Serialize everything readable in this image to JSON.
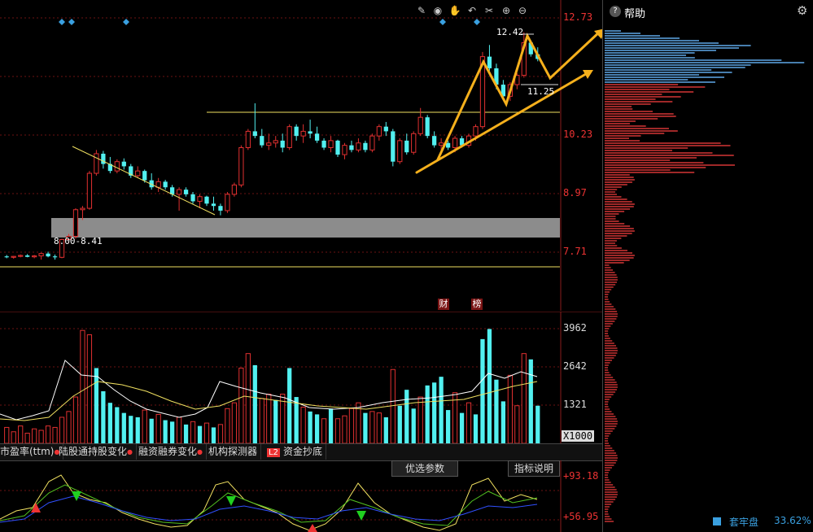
{
  "toolbar": {
    "icons": [
      "pen-icon",
      "eye-icon",
      "hand-icon",
      "undo-icon",
      "scissors-icon",
      "zoom-in-icon",
      "zoom-out-icon"
    ]
  },
  "price_axis": {
    "ticks": [
      "12.73",
      "10.23",
      "8.97",
      "7.71"
    ]
  },
  "annotations": {
    "support_zone_label": "8.00-8.41",
    "high_label": "12.42",
    "low_label": "11.25",
    "finance_badge": "财",
    "ranking_badge": "榜"
  },
  "volume_axis": {
    "ticks": [
      "3962",
      "2642",
      "1321"
    ],
    "unit": "X1000"
  },
  "indicator_tabs": [
    {
      "label": "市盈率(ttm)"
    },
    {
      "label": "陆股通持股变化"
    },
    {
      "label": "融资融券变化"
    },
    {
      "label": "机构探测器"
    },
    {
      "label": "资金抄底",
      "badge": "L2"
    }
  ],
  "indicator_panel": {
    "optimize_button": "优选参数",
    "explain_button": "指标说明",
    "ticks": [
      "+93.18",
      "+56.95"
    ]
  },
  "sidebar": {
    "help_title": "帮助",
    "footer_label": "套牢盘",
    "footer_value": "33.62%"
  },
  "colors": {
    "up": "#e03030",
    "down": "#52f0f0",
    "accent": "#f5b01c",
    "trend": "#f0e060"
  },
  "chart_data": {
    "type": "candlestick",
    "y_range": [
      7.2,
      12.9
    ],
    "candles": [
      [
        7.62,
        7.65,
        7.58,
        7.6
      ],
      [
        7.6,
        7.63,
        7.57,
        7.62
      ],
      [
        7.62,
        7.66,
        7.6,
        7.64
      ],
      [
        7.64,
        7.67,
        7.6,
        7.61
      ],
      [
        7.61,
        7.65,
        7.58,
        7.63
      ],
      [
        7.63,
        7.7,
        7.55,
        7.68
      ],
      [
        7.68,
        7.72,
        7.6,
        7.62
      ],
      [
        7.62,
        7.66,
        7.55,
        7.6
      ],
      [
        7.6,
        8.0,
        7.58,
        7.98
      ],
      [
        7.98,
        8.1,
        7.9,
        8.05
      ],
      [
        8.05,
        8.65,
        8.0,
        8.62
      ],
      [
        8.62,
        8.7,
        8.4,
        8.65
      ],
      [
        8.65,
        9.45,
        8.62,
        9.4
      ],
      [
        9.4,
        9.9,
        9.35,
        9.82
      ],
      [
        9.82,
        9.88,
        9.5,
        9.6
      ],
      [
        9.6,
        9.75,
        9.4,
        9.45
      ],
      [
        9.45,
        9.7,
        9.4,
        9.65
      ],
      [
        9.65,
        9.72,
        9.48,
        9.55
      ],
      [
        9.55,
        9.6,
        9.3,
        9.35
      ],
      [
        9.35,
        9.55,
        9.3,
        9.45
      ],
      [
        9.45,
        9.48,
        9.2,
        9.25
      ],
      [
        9.25,
        9.4,
        9.05,
        9.1
      ],
      [
        9.1,
        9.3,
        9.0,
        9.22
      ],
      [
        9.22,
        9.26,
        9.05,
        9.1
      ],
      [
        9.1,
        9.15,
        8.9,
        8.95
      ],
      [
        8.95,
        9.1,
        8.6,
        9.05
      ],
      [
        9.05,
        9.1,
        8.9,
        8.95
      ],
      [
        8.95,
        9.0,
        8.75,
        8.8
      ],
      [
        8.8,
        8.95,
        8.65,
        8.9
      ],
      [
        8.9,
        8.92,
        8.7,
        8.75
      ],
      [
        8.75,
        8.9,
        8.6,
        8.7
      ],
      [
        8.7,
        8.75,
        8.5,
        8.6
      ],
      [
        8.6,
        9.0,
        8.55,
        8.95
      ],
      [
        8.95,
        9.2,
        8.9,
        9.15
      ],
      [
        9.15,
        10.0,
        9.1,
        9.95
      ],
      [
        9.95,
        10.35,
        9.9,
        10.3
      ],
      [
        10.3,
        10.9,
        10.15,
        10.2
      ],
      [
        10.2,
        10.35,
        9.95,
        10.0
      ],
      [
        10.0,
        10.25,
        9.9,
        10.05
      ],
      [
        10.05,
        10.2,
        9.95,
        10.1
      ],
      [
        10.1,
        10.25,
        9.85,
        9.95
      ],
      [
        9.95,
        10.45,
        9.9,
        10.4
      ],
      [
        10.4,
        10.45,
        10.1,
        10.2
      ],
      [
        10.2,
        10.45,
        10.05,
        10.3
      ],
      [
        10.3,
        10.55,
        10.15,
        10.25
      ],
      [
        10.25,
        10.4,
        10.05,
        10.1
      ],
      [
        10.1,
        10.15,
        9.9,
        9.95
      ],
      [
        9.95,
        10.2,
        9.85,
        10.1
      ],
      [
        10.1,
        10.12,
        9.75,
        9.8
      ],
      [
        9.8,
        10.05,
        9.7,
        10.0
      ],
      [
        10.0,
        10.1,
        9.85,
        9.9
      ],
      [
        9.9,
        10.15,
        9.85,
        10.05
      ],
      [
        10.05,
        10.1,
        9.85,
        9.9
      ],
      [
        9.9,
        10.25,
        9.85,
        10.2
      ],
      [
        10.2,
        10.45,
        10.1,
        10.4
      ],
      [
        10.4,
        10.5,
        10.2,
        10.3
      ],
      [
        10.3,
        10.35,
        9.55,
        9.65
      ],
      [
        9.65,
        10.15,
        9.6,
        10.1
      ],
      [
        10.1,
        10.25,
        9.8,
        9.85
      ],
      [
        9.85,
        10.3,
        9.8,
        10.25
      ],
      [
        10.25,
        10.8,
        10.2,
        10.6
      ],
      [
        10.6,
        10.65,
        10.15,
        10.2
      ],
      [
        10.2,
        10.3,
        9.95,
        10.0
      ],
      [
        10.0,
        10.15,
        9.8,
        10.05
      ],
      [
        10.05,
        10.1,
        9.9,
        9.95
      ],
      [
        9.95,
        10.2,
        9.85,
        10.15
      ],
      [
        10.15,
        10.2,
        9.95,
        10.0
      ],
      [
        10.0,
        10.25,
        9.95,
        10.2
      ],
      [
        10.2,
        10.45,
        10.1,
        10.4
      ],
      [
        10.4,
        12.0,
        10.35,
        11.9
      ],
      [
        11.9,
        12.15,
        11.6,
        11.65
      ],
      [
        11.65,
        11.75,
        11.2,
        11.3
      ],
      [
        11.3,
        11.4,
        11.0,
        11.05
      ],
      [
        11.05,
        11.35,
        10.95,
        11.3
      ],
      [
        11.3,
        11.55,
        11.2,
        11.5
      ],
      [
        11.5,
        12.42,
        11.45,
        12.2
      ],
      [
        12.2,
        12.25,
        11.9,
        11.95
      ],
      [
        11.95,
        12.1,
        11.8,
        11.85
      ]
    ],
    "volume": [
      [
        0.55,
        "up"
      ],
      [
        0.4,
        "up"
      ],
      [
        0.6,
        "up"
      ],
      [
        0.35,
        "up"
      ],
      [
        0.5,
        "up"
      ],
      [
        0.45,
        "up"
      ],
      [
        0.6,
        "up"
      ],
      [
        0.55,
        "up"
      ],
      [
        0.9,
        "up"
      ],
      [
        1.1,
        "up"
      ],
      [
        1.6,
        "up"
      ],
      [
        3.9,
        "up"
      ],
      [
        3.75,
        "up"
      ],
      [
        2.6,
        "down"
      ],
      [
        1.8,
        "down"
      ],
      [
        1.4,
        "down"
      ],
      [
        1.25,
        "down"
      ],
      [
        1.05,
        "down"
      ],
      [
        0.95,
        "down"
      ],
      [
        0.9,
        "down"
      ],
      [
        1.15,
        "up"
      ],
      [
        0.85,
        "down"
      ],
      [
        1.0,
        "up"
      ],
      [
        0.8,
        "down"
      ],
      [
        0.75,
        "down"
      ],
      [
        0.9,
        "up"
      ],
      [
        0.65,
        "down"
      ],
      [
        0.75,
        "up"
      ],
      [
        0.6,
        "down"
      ],
      [
        0.7,
        "up"
      ],
      [
        0.55,
        "down"
      ],
      [
        0.65,
        "up"
      ],
      [
        1.2,
        "up"
      ],
      [
        1.4,
        "up"
      ],
      [
        2.6,
        "up"
      ],
      [
        3.1,
        "up"
      ],
      [
        2.7,
        "down"
      ],
      [
        1.55,
        "up"
      ],
      [
        1.7,
        "up"
      ],
      [
        1.5,
        "down"
      ],
      [
        1.7,
        "up"
      ],
      [
        2.6,
        "down"
      ],
      [
        1.6,
        "down"
      ],
      [
        1.25,
        "up"
      ],
      [
        1.1,
        "down"
      ],
      [
        1.0,
        "down"
      ],
      [
        0.85,
        "up"
      ],
      [
        1.2,
        "down"
      ],
      [
        0.85,
        "up"
      ],
      [
        0.95,
        "up"
      ],
      [
        1.2,
        "up"
      ],
      [
        1.4,
        "up"
      ],
      [
        1.05,
        "down"
      ],
      [
        1.1,
        "up"
      ],
      [
        1.05,
        "up"
      ],
      [
        0.9,
        "down"
      ],
      [
        2.55,
        "up"
      ],
      [
        1.3,
        "down"
      ],
      [
        1.85,
        "down"
      ],
      [
        1.2,
        "down"
      ],
      [
        1.6,
        "up"
      ],
      [
        2.0,
        "down"
      ],
      [
        2.1,
        "down"
      ],
      [
        2.3,
        "down"
      ],
      [
        1.15,
        "down"
      ],
      [
        1.75,
        "up"
      ],
      [
        1.05,
        "down"
      ],
      [
        1.4,
        "up"
      ],
      [
        1.0,
        "down"
      ],
      [
        3.6,
        "down"
      ],
      [
        3.95,
        "down"
      ],
      [
        2.2,
        "down"
      ],
      [
        1.45,
        "down"
      ],
      [
        2.35,
        "up"
      ],
      [
        1.3,
        "up"
      ],
      [
        3.1,
        "up"
      ],
      [
        2.9,
        "down"
      ],
      [
        1.3,
        "down"
      ]
    ]
  }
}
